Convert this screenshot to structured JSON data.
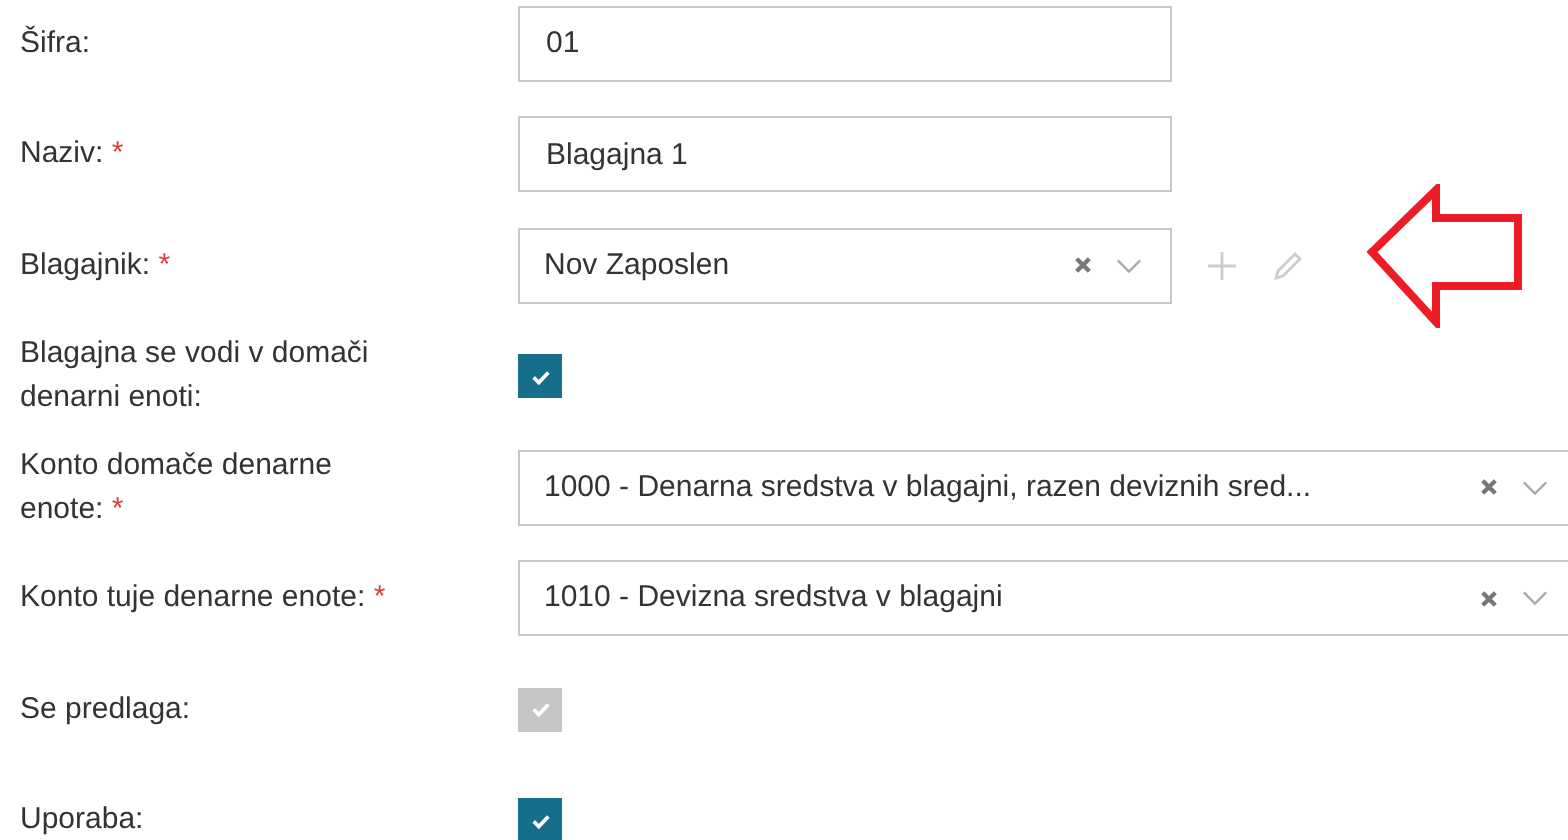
{
  "fields": [
    {
      "kind": "text",
      "label": "Šifra:",
      "value": "01"
    },
    {
      "kind": "text",
      "label": "Naziv:",
      "required_mark": "*",
      "value": "Blagajna 1"
    },
    {
      "kind": "select",
      "label": "Blagajnik:",
      "required_mark": "*",
      "value": "Nov Zaposlen",
      "wide": false,
      "actions": [
        {
          "kind": "add"
        },
        {
          "kind": "edit"
        }
      ]
    },
    {
      "kind": "checkbox",
      "label": "Blagajna se vodi v domači denarni enoti:",
      "checked": true,
      "disabled": false
    },
    {
      "kind": "select",
      "label": "Konto domače denarne enote:",
      "required_mark": "*",
      "value": "1000 - Denarna sredstva v blagajni, razen deviznih sred...",
      "wide": true
    },
    {
      "kind": "select",
      "label": "Konto tuje denarne enote:",
      "required_mark": "*",
      "value": "1010 - Devizna sredstva v blagajni",
      "wide": true
    },
    {
      "kind": "checkbox",
      "label": "Se predlaga:",
      "checked": true,
      "disabled": true
    },
    {
      "kind": "checkbox",
      "label": "Uporaba:",
      "checked": true,
      "disabled": false
    }
  ],
  "annotation": {
    "kind": "arrow"
  }
}
